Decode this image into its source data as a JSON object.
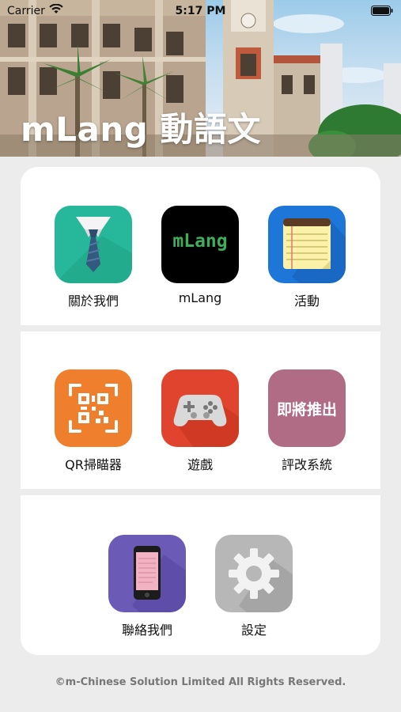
{
  "status_bar": {
    "carrier": "Carrier",
    "time": "5:17 PM"
  },
  "header": {
    "title": "mLang 動語文"
  },
  "menu": {
    "about": {
      "label": "關於我們",
      "icon": "necktie-icon"
    },
    "mlang": {
      "label": "mLang",
      "icon_text": "mLang"
    },
    "events": {
      "label": "活動",
      "icon": "notepad-icon"
    },
    "qr": {
      "label": "QR掃瞄器",
      "icon": "qr-code-icon"
    },
    "games": {
      "label": "遊戲",
      "icon": "gamepad-icon"
    },
    "grading": {
      "label": "評改系統",
      "icon_text": "即將推出"
    },
    "contact": {
      "label": "聯絡我們",
      "icon": "phone-icon"
    },
    "settings": {
      "label": "設定",
      "icon": "gear-icon"
    }
  },
  "footer": {
    "copyright": "©m-Chinese Solution Limited All Rights Reserved."
  }
}
